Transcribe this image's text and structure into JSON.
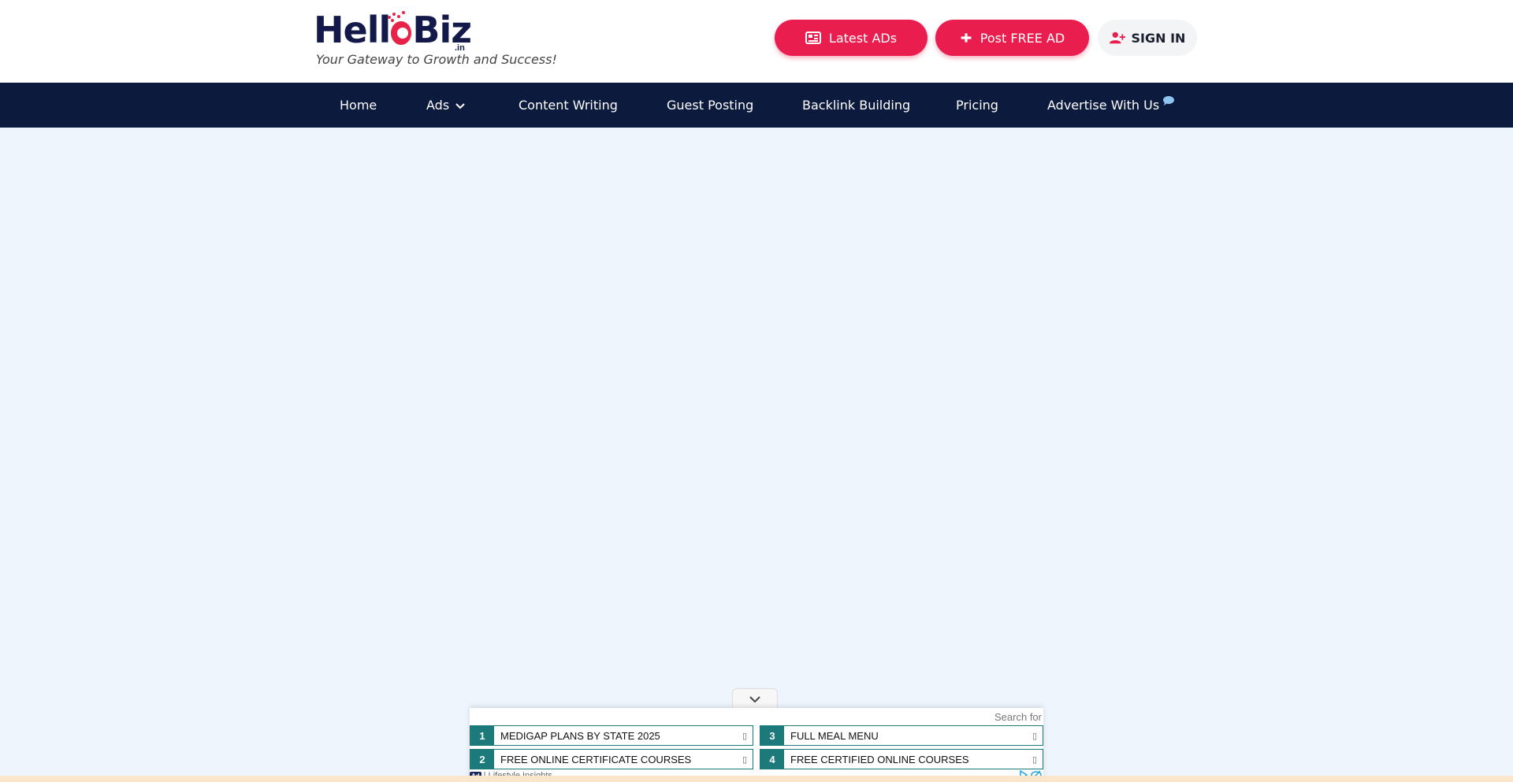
{
  "header": {
    "logo_text_left": "Hell",
    "logo_text_right": "Biz",
    "logo_suffix": ".in",
    "tagline": "Your Gateway to Growth and Success!",
    "buttons": {
      "latest_ads": "Latest ADs",
      "post_free_ad": "Post FREE AD",
      "sign_in": "SIGN IN"
    },
    "accent_color": "#ea1e4e"
  },
  "nav": {
    "items": [
      {
        "label": "Home"
      },
      {
        "label": "Ads"
      },
      {
        "label": "Content Writing"
      },
      {
        "label": "Guest Posting"
      },
      {
        "label": "Backlink Building"
      },
      {
        "label": "Pricing"
      },
      {
        "label": "Advertise With Us"
      }
    ],
    "background": "#0c1a3d"
  },
  "ad_unit": {
    "search_label": "Search for",
    "rows": [
      {
        "num": "1",
        "text": "MEDIGAP PLANS BY STATE 2025"
      },
      {
        "num": "3",
        "text": "FULL MEAL MENU"
      },
      {
        "num": "2",
        "text": "FREE ONLINE CERTIFICATE COURSES"
      },
      {
        "num": "4",
        "text": "FREE CERTIFIED ONLINE COURSES"
      }
    ],
    "badge": "Ad",
    "sponsor": "| Lifestyle Insights",
    "row_color": "#1d7a7b"
  }
}
